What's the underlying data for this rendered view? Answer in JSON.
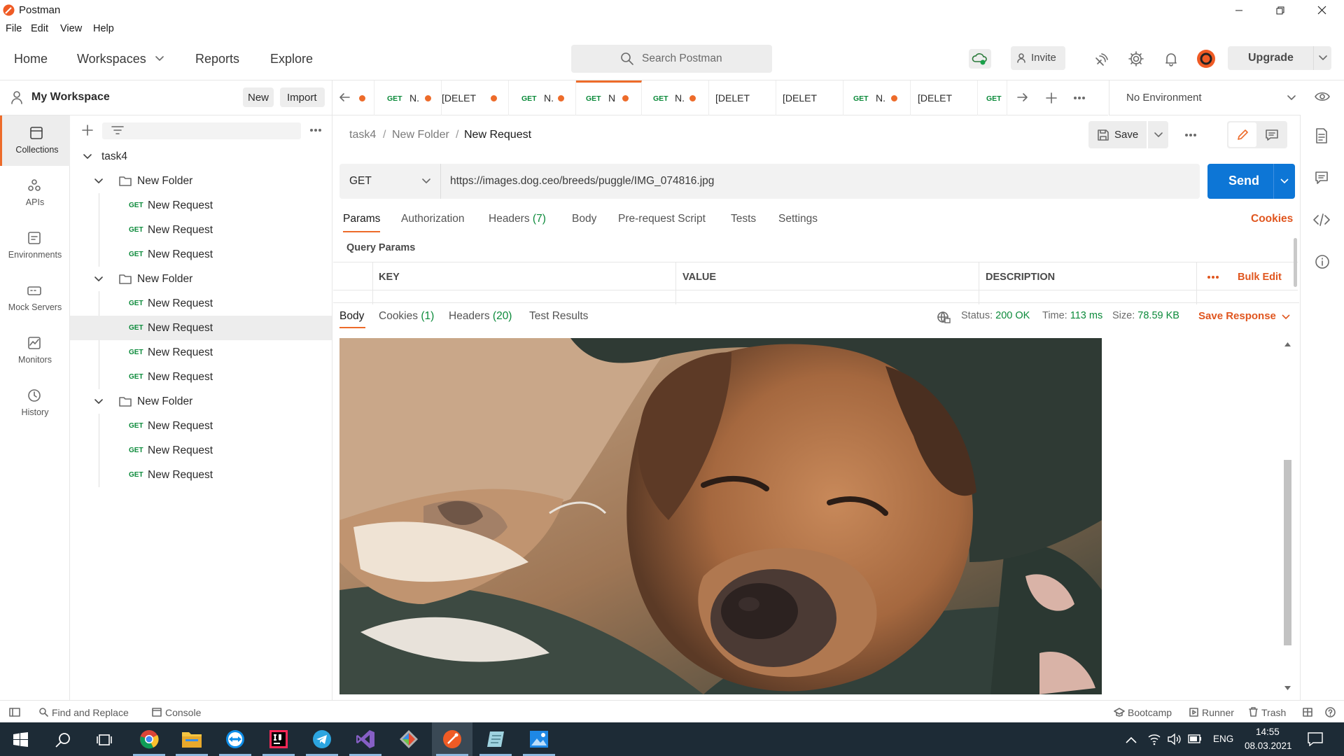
{
  "window": {
    "title": "Postman"
  },
  "menu": [
    "File",
    "Edit",
    "View",
    "Help"
  ],
  "header": {
    "nav": [
      "Home",
      "Workspaces",
      "Reports",
      "Explore"
    ],
    "search_placeholder": "Search Postman",
    "invite": "Invite",
    "upgrade": "Upgrade"
  },
  "workspace": {
    "name": "My Workspace",
    "new": "New",
    "import": "Import"
  },
  "leftnav": [
    "Collections",
    "APIs",
    "Environments",
    "Mock Servers",
    "Monitors",
    "History"
  ],
  "tree": {
    "collection": "task4",
    "folders": [
      {
        "name": "New Folder",
        "requests": [
          {
            "method": "GET",
            "name": "New Request"
          },
          {
            "method": "GET",
            "name": "New Request"
          },
          {
            "method": "GET",
            "name": "New Request"
          }
        ]
      },
      {
        "name": "New Folder",
        "requests": [
          {
            "method": "GET",
            "name": "New Request"
          },
          {
            "method": "GET",
            "name": "New Request"
          },
          {
            "method": "GET",
            "name": "New Request"
          },
          {
            "method": "GET",
            "name": "New Request"
          }
        ]
      },
      {
        "name": "New Folder",
        "requests": [
          {
            "method": "GET",
            "name": "New Request"
          },
          {
            "method": "GET",
            "name": "New Request"
          },
          {
            "method": "GET",
            "name": "New Request"
          }
        ]
      }
    ]
  },
  "tabs": [
    {
      "method": "",
      "name": ""
    },
    {
      "method": "GET",
      "name": "N."
    },
    {
      "method": "",
      "name": "[DELET"
    },
    {
      "method": "GET",
      "name": "N."
    },
    {
      "method": "GET",
      "name": "N"
    },
    {
      "method": "GET",
      "name": "N."
    },
    {
      "method": "",
      "name": "[DELET"
    },
    {
      "method": "",
      "name": "[DELET"
    },
    {
      "method": "GET",
      "name": "N."
    },
    {
      "method": "",
      "name": "[DELET"
    },
    {
      "method": "GET",
      "name": ""
    }
  ],
  "environment": "No Environment",
  "breadcrumb": [
    "task4",
    "New Folder",
    "New Request"
  ],
  "save": "Save",
  "request": {
    "method": "GET",
    "url": "https://images.dog.ceo/breeds/puggle/IMG_074816.jpg",
    "send": "Send",
    "tabs": {
      "params": "Params",
      "authorization": "Authorization",
      "headers": "Headers",
      "headers_count": "(7)",
      "body": "Body",
      "prerequest": "Pre-request Script",
      "tests": "Tests",
      "settings": "Settings"
    },
    "cookies": "Cookies",
    "query_params": "Query Params",
    "columns": [
      "KEY",
      "VALUE",
      "DESCRIPTION"
    ],
    "bulk_edit": "Bulk Edit"
  },
  "response": {
    "tabs": {
      "body": "Body",
      "cookies": "Cookies",
      "cookies_count": "(1)",
      "headers": "Headers",
      "headers_count": "(20)",
      "tests": "Test Results"
    },
    "status_label": "Status:",
    "status": "200 OK",
    "time_label": "Time:",
    "time": "113 ms",
    "size_label": "Size:",
    "size": "78.59 KB",
    "save_response": "Save Response"
  },
  "statusbar": {
    "find": "Find and Replace",
    "console": "Console",
    "bootcamp": "Bootcamp",
    "runner": "Runner",
    "trash": "Trash"
  },
  "taskbar": {
    "lang": "ENG",
    "time": "14:55",
    "date": "08.03.2021"
  },
  "colors": {
    "accent": "#ED6B2A",
    "send": "#0D76D6",
    "get": "#0B8A3A",
    "taskbar": "#1D2B36"
  }
}
